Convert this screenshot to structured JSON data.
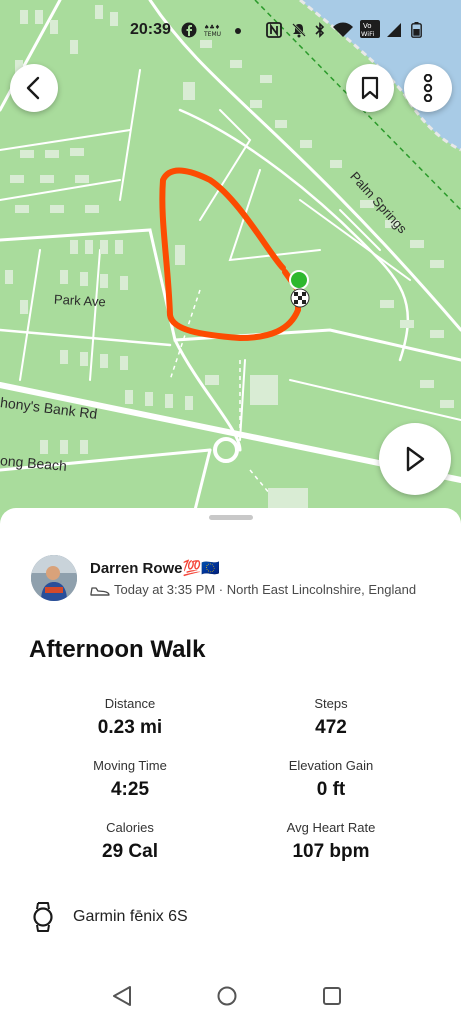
{
  "status_bar": {
    "time": "20:39",
    "icons": [
      "facebook-icon",
      "temu-icon",
      "dot-icon",
      "nfc-icon",
      "mute-icon",
      "bluetooth-icon",
      "wifi-icon",
      "vowifi-icon",
      "signal-icon",
      "battery-icon"
    ],
    "vowifi_text": "Vo\nWiFi"
  },
  "map": {
    "labels": {
      "park_ave": "Park Ave",
      "bank_rd": "hony's Bank Rd",
      "long_beach": "ong Beach",
      "palm_springs": "Palm Springs"
    },
    "route_color": "#fc4c02",
    "start_marker_color": "#2eb82e",
    "background_color": "#a9dc9c"
  },
  "buttons": {
    "back": "back-arrow-icon",
    "bookmark": "bookmark-icon",
    "more": "more-vertical-icon",
    "play": "play-icon"
  },
  "athlete": {
    "name": "Darren Rowe💯🇪🇺",
    "meta": "Today at 3:35 PM · North East Lincolnshire, England"
  },
  "activity": {
    "title": "Afternoon Walk",
    "stats": [
      {
        "label": "Distance",
        "value": "0.23 mi"
      },
      {
        "label": "Steps",
        "value": "472"
      },
      {
        "label": "Moving Time",
        "value": "4:25"
      },
      {
        "label": "Elevation Gain",
        "value": "0 ft"
      },
      {
        "label": "Calories",
        "value": "29 Cal"
      },
      {
        "label": "Avg Heart Rate",
        "value": "107 bpm"
      }
    ],
    "device": "Garmin fēnix 6S"
  },
  "nav_bar": {
    "buttons": [
      "nav-back-icon",
      "nav-home-icon",
      "nav-recents-icon"
    ]
  }
}
